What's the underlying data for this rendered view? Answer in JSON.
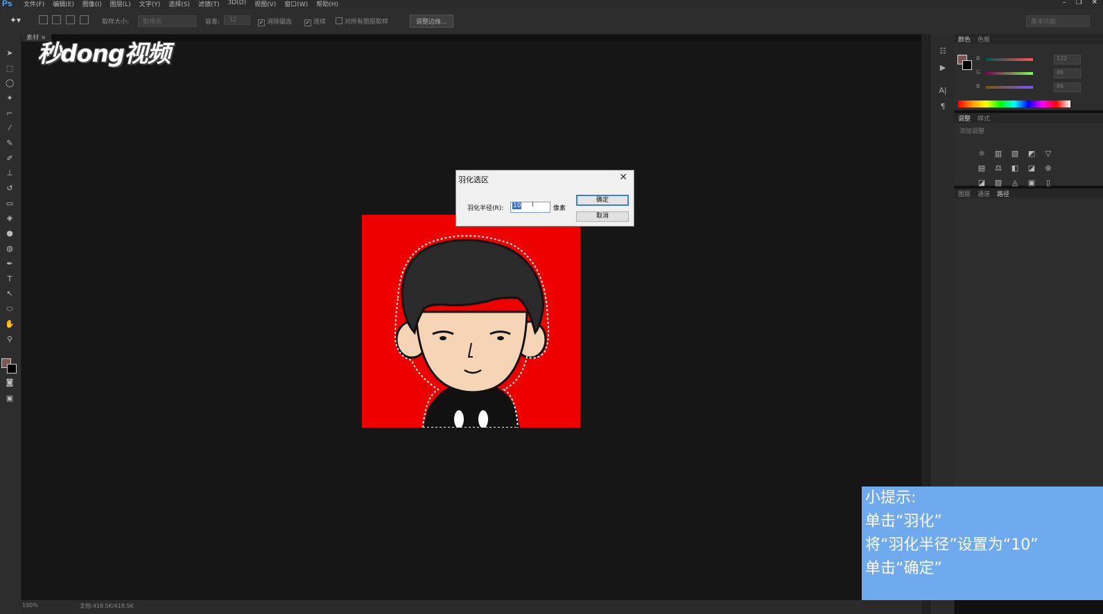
{
  "app": {
    "logo": "Ps"
  },
  "menu": [
    "文件(F)",
    "编辑(E)",
    "图像(I)",
    "图层(L)",
    "文字(Y)",
    "选择(S)",
    "滤镜(T)",
    "3D(D)",
    "视图(V)",
    "窗口(W)",
    "帮助(H)"
  ],
  "options": {
    "sample_size_label": "取样大小:",
    "sample_size_value": "取样点",
    "tolerance_label": "容差:",
    "tolerance_value": "32",
    "antialias_label": "消除锯齿",
    "contiguous_label": "连续",
    "all_layers_label": "对所有图层取样",
    "refine_edge_button": "调整边缘...",
    "workspace": "基本功能"
  },
  "document_tab": "素材",
  "watermark": "秒dong视频",
  "dialog": {
    "title": "羽化选区",
    "radius_label": "羽化半径(R):",
    "radius_value": "10",
    "unit": "像素",
    "ok": "确定",
    "cancel": "取消"
  },
  "panels": {
    "color_tabs": [
      "颜色",
      "色板"
    ],
    "rgb": [
      {
        "label": "R",
        "value": "122"
      },
      {
        "label": "G",
        "value": "86"
      },
      {
        "label": "B",
        "value": "86"
      }
    ],
    "adjust_tabs": [
      "调整",
      "样式"
    ],
    "adjust_hint": "添加调整",
    "layer_tabs": [
      "图层",
      "通道",
      "路径"
    ]
  },
  "status": {
    "zoom": "100%",
    "doc_info": "文档:418.5K/418.5K"
  },
  "tip": {
    "lines": [
      "小提示:",
      "单击“羽化”",
      "将“羽化半径”设置为“10”",
      "单击“确定”"
    ]
  },
  "colors": {
    "accent": "#3370d4",
    "photo_bg": "#ee0000",
    "tip_bg": "#6fa9ee"
  }
}
